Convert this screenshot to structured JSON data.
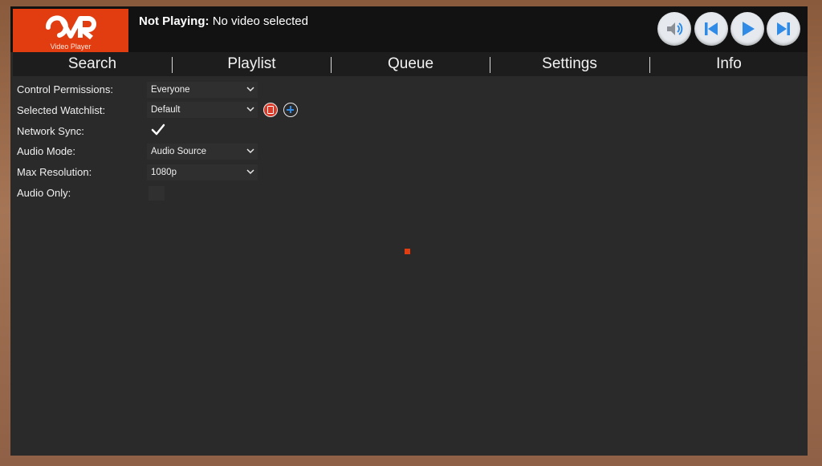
{
  "app": {
    "logo_text": "CVR",
    "logo_subtitle": "Video Player",
    "brand_color": "#e13d10"
  },
  "header": {
    "status_label": "Not Playing:",
    "status_text": "No video selected"
  },
  "controls": {
    "volume_icon": "speaker-icon",
    "prev_icon": "skip-previous-icon",
    "play_icon": "play-icon",
    "next_icon": "skip-next-icon",
    "icon_color": "#2f8be6"
  },
  "tabs": [
    {
      "label": "Search"
    },
    {
      "label": "Playlist"
    },
    {
      "label": "Queue"
    },
    {
      "label": "Settings"
    },
    {
      "label": "Info"
    }
  ],
  "settings": {
    "control_permissions": {
      "label": "Control Permissions:",
      "value": "Everyone"
    },
    "selected_watchlist": {
      "label": "Selected Watchlist:",
      "value": "Default"
    },
    "network_sync": {
      "label": "Network Sync:",
      "checked": true
    },
    "audio_mode": {
      "label": "Audio Mode:",
      "value": "Audio Source"
    },
    "max_resolution": {
      "label": "Max Resolution:",
      "value": "1080p"
    },
    "audio_only": {
      "label": "Audio Only:",
      "checked": false
    }
  }
}
